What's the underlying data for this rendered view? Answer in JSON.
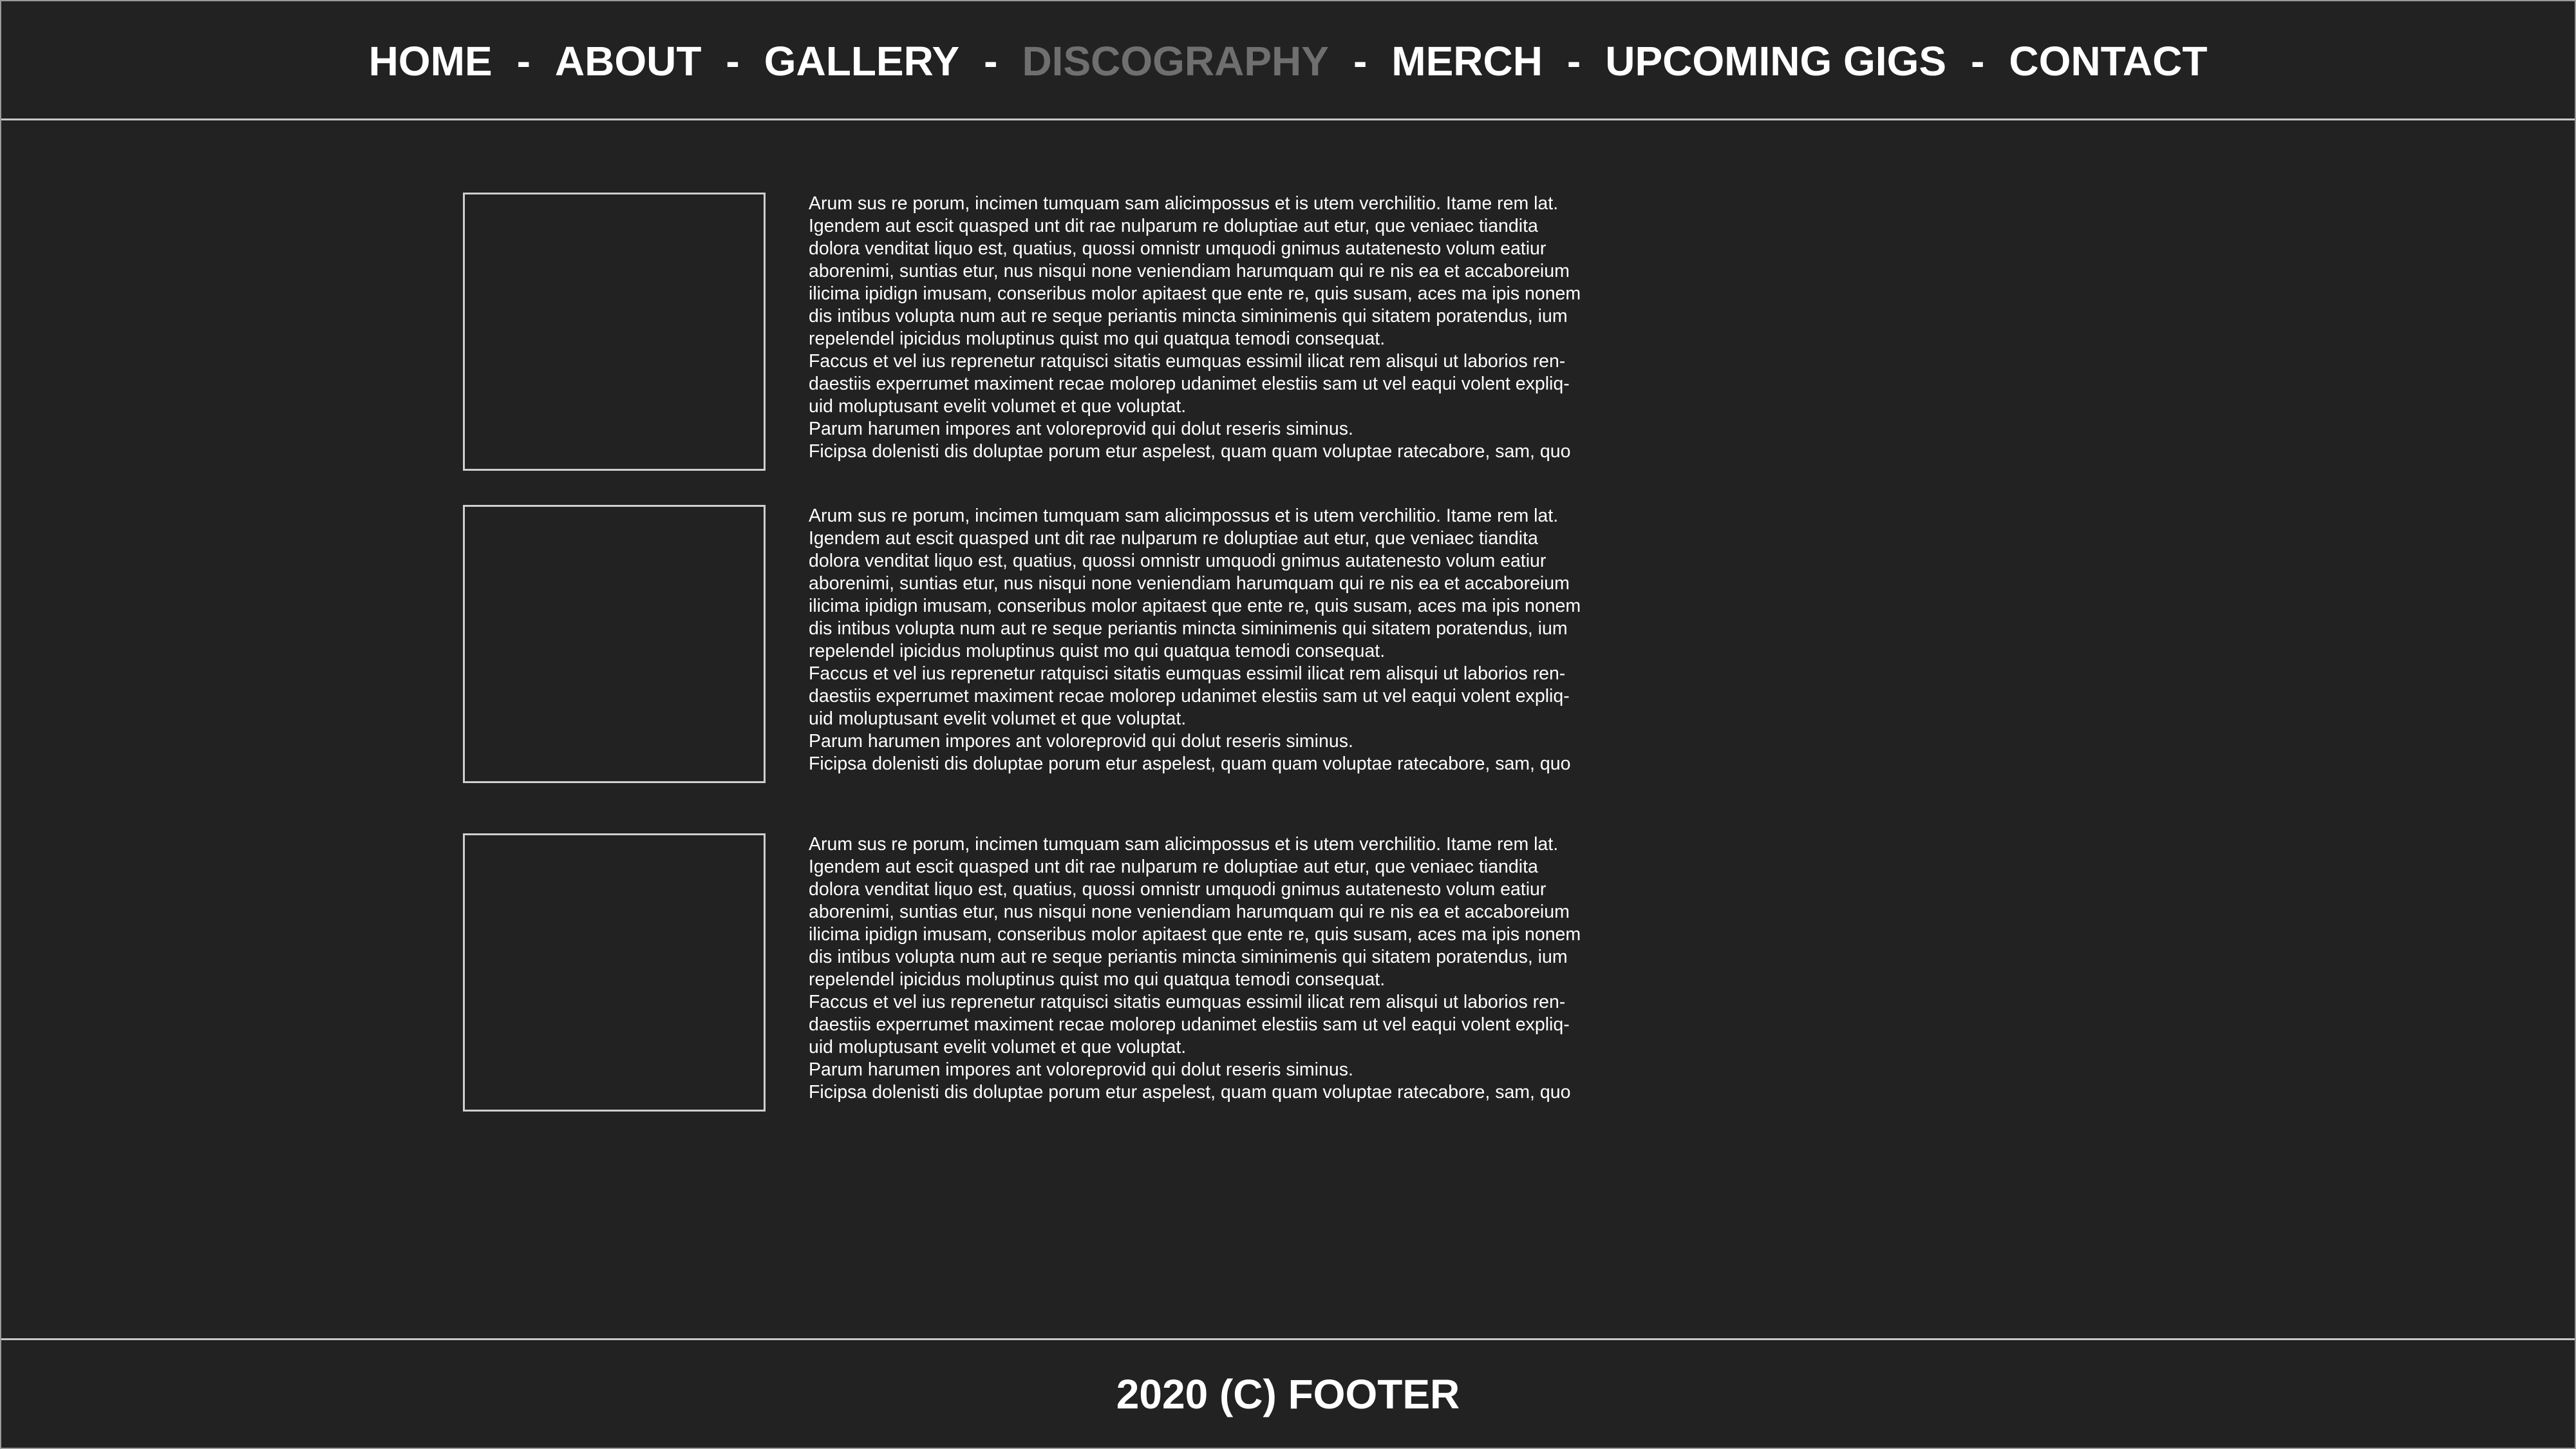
{
  "nav": {
    "items": [
      {
        "label": "HOME",
        "active": false
      },
      {
        "label": "ABOUT",
        "active": false
      },
      {
        "label": "GALLERY",
        "active": false
      },
      {
        "label": "DISCOGRAPHY",
        "active": true
      },
      {
        "label": "MERCH",
        "active": false
      },
      {
        "label": "UPCOMING GIGS",
        "active": false
      },
      {
        "label": "CONTACT",
        "active": false
      }
    ],
    "separator": "-"
  },
  "albums": [
    {
      "lines": [
        "Arum sus re porum, incimen tumquam sam alicimpossus et is utem verchilitio. Itame rem lat.",
        "Igendem aut escit quasped unt dit rae nulparum re doluptiae aut etur, que veniaec tiandita",
        "dolora venditat liquo est, quatius, quossi omnistr umquodi gnimus autatenesto volum eatiur",
        "aborenimi, suntias etur, nus nisqui none veniendiam harumquam qui re nis ea et accaboreium",
        "ilicima ipidign imusam, conseribus molor apitaest que ente re, quis susam, aces ma ipis nonem",
        "dis intibus volupta num aut re seque periantis mincta siminimenis qui sitatem poratendus, ium",
        "repelendel ipicidus moluptinus quist mo qui quatqua temodi consequat.",
        "Faccus et vel ius reprenetur ratquisci sitatis eumquas essimil ilicat rem alisqui ut laborios ren-",
        "daestiis experrumet maximent recae molorep udanimet elestiis sam ut vel eaqui volent expliq-",
        "uid moluptusant evelit volumet et que voluptat.",
        "Parum harumen impores ant voloreprovid qui dolut reseris siminus.",
        "Ficipsa dolenisti dis doluptae porum etur aspelest, quam quam voluptae ratecabore, sam, quo"
      ]
    },
    {
      "lines": [
        "Arum sus re porum, incimen tumquam sam alicimpossus et is utem verchilitio. Itame rem lat.",
        "Igendem aut escit quasped unt dit rae nulparum re doluptiae aut etur, que veniaec tiandita",
        "dolora venditat liquo est, quatius, quossi omnistr umquodi gnimus autatenesto volum eatiur",
        "aborenimi, suntias etur, nus nisqui none veniendiam harumquam qui re nis ea et accaboreium",
        "ilicima ipidign imusam, conseribus molor apitaest que ente re, quis susam, aces ma ipis nonem",
        "dis intibus volupta num aut re seque periantis mincta siminimenis qui sitatem poratendus, ium",
        "repelendel ipicidus moluptinus quist mo qui quatqua temodi consequat.",
        "Faccus et vel ius reprenetur ratquisci sitatis eumquas essimil ilicat rem alisqui ut laborios ren-",
        "daestiis experrumet maximent recae molorep udanimet elestiis sam ut vel eaqui volent expliq-",
        "uid moluptusant evelit volumet et que voluptat.",
        "Parum harumen impores ant voloreprovid qui dolut reseris siminus.",
        "Ficipsa dolenisti dis doluptae porum etur aspelest, quam quam voluptae ratecabore, sam, quo"
      ]
    },
    {
      "lines": [
        "Arum sus re porum, incimen tumquam sam alicimpossus et is utem verchilitio. Itame rem lat.",
        "Igendem aut escit quasped unt dit rae nulparum re doluptiae aut etur, que veniaec tiandita",
        "dolora venditat liquo est, quatius, quossi omnistr umquodi gnimus autatenesto volum eatiur",
        "aborenimi, suntias etur, nus nisqui none veniendiam harumquam qui re nis ea et accaboreium",
        "ilicima ipidign imusam, conseribus molor apitaest que ente re, quis susam, aces ma ipis nonem",
        "dis intibus volupta num aut re seque periantis mincta siminimenis qui sitatem poratendus, ium",
        "repelendel ipicidus moluptinus quist mo qui quatqua temodi consequat.",
        "Faccus et vel ius reprenetur ratquisci sitatis eumquas essimil ilicat rem alisqui ut laborios ren-",
        "daestiis experrumet maximent recae molorep udanimet elestiis sam ut vel eaqui volent expliq-",
        "uid moluptusant evelit volumet et que voluptat.",
        "Parum harumen impores ant voloreprovid qui dolut reseris siminus.",
        "Ficipsa dolenisti dis doluptae porum etur aspelest, quam quam voluptae ratecabore, sam, quo"
      ]
    }
  ],
  "footer": {
    "text": "2020 (C) FOOTER"
  },
  "colors": {
    "background": "#222222",
    "text": "#ffffff",
    "active_nav": "#6f6f6f",
    "border": "#c8c8c8"
  }
}
